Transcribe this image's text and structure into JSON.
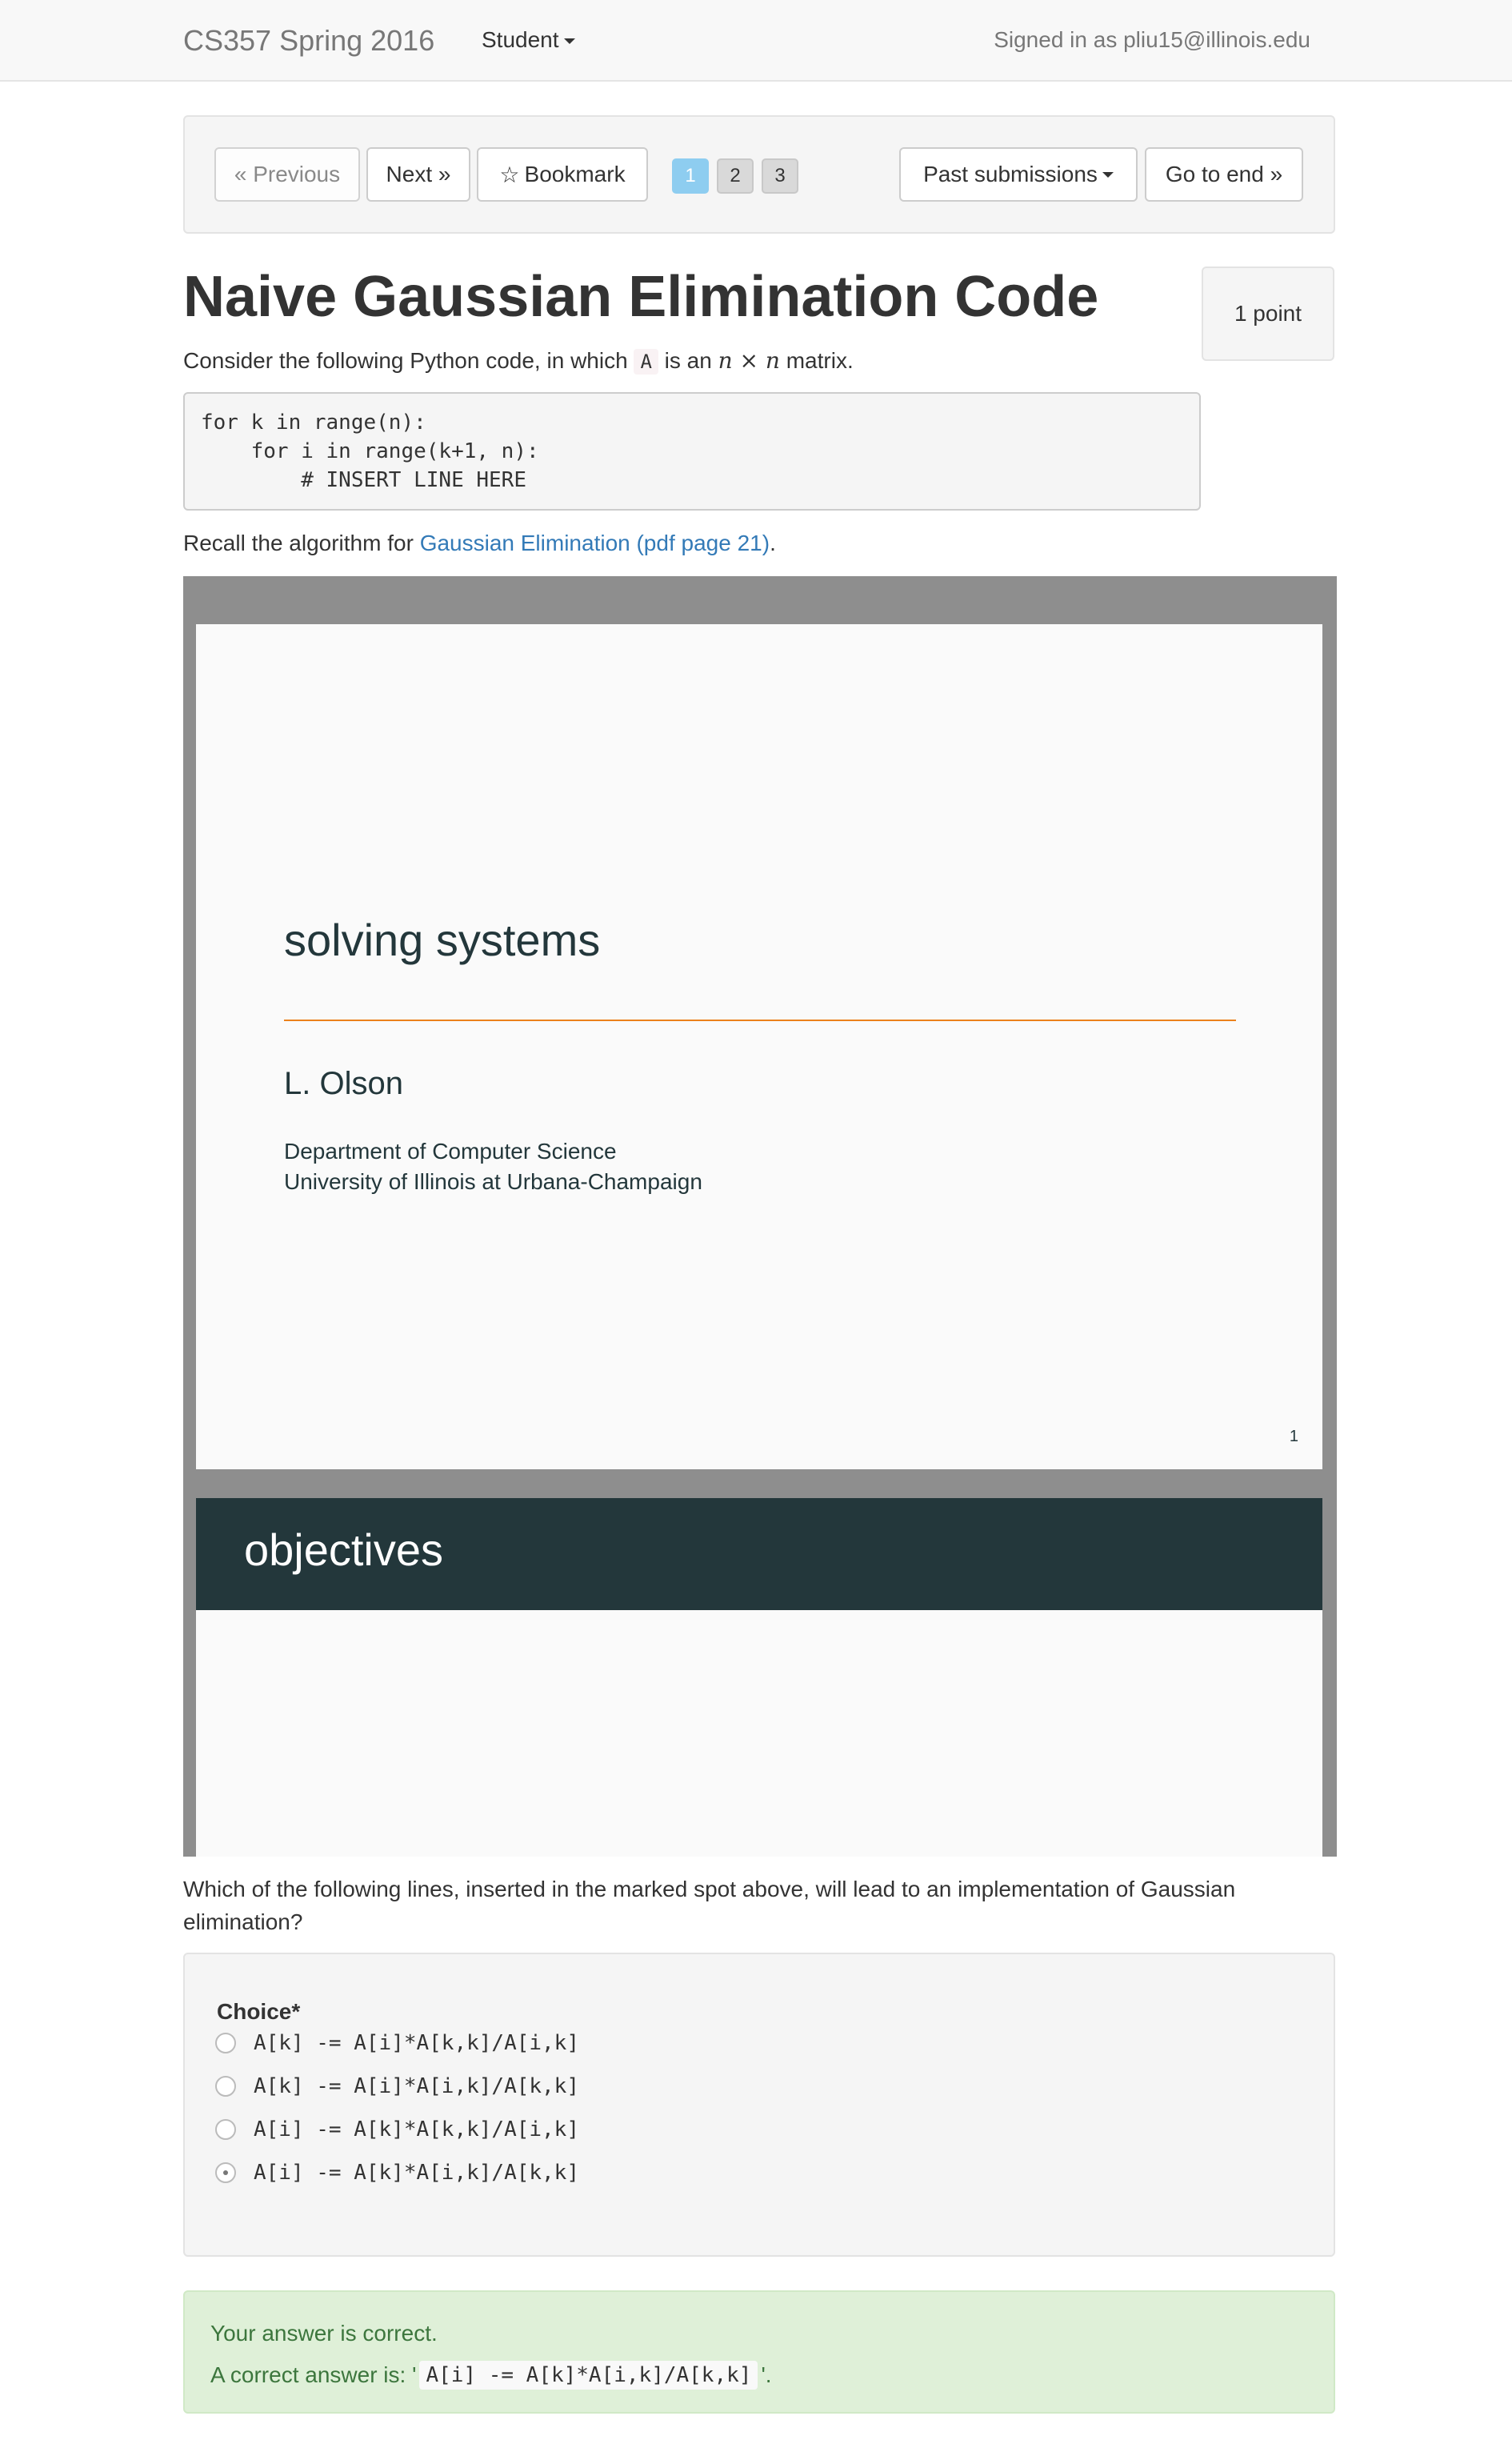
{
  "navbar": {
    "brand": "CS357 Spring 2016",
    "role": "Student",
    "signed_in": "Signed in as pliu15@illinois.edu"
  },
  "pager": {
    "previous": "« Previous",
    "next": "Next »",
    "bookmark": "Bookmark",
    "pages": [
      "1",
      "2",
      "3"
    ],
    "active_page": "1",
    "past_submissions": "Past submissions",
    "go_to_end": "Go to end »"
  },
  "question": {
    "title": "Naive Gaussian Elimination Code",
    "points": "1 point",
    "prompt_before": "Consider the following Python code, in which",
    "prompt_var": "A",
    "prompt_mid": "is an",
    "prompt_math": "n × n",
    "prompt_after": "matrix.",
    "code_line_1": "for k in range(n):",
    "code_line_2": "    for i in range(k+1, n):",
    "code_line_3": "        # INSERT LINE HERE",
    "recall_before": "Recall the algorithm for",
    "recall_link": "Gaussian Elimination (pdf page 21)",
    "recall_after": ".",
    "body": "Which of the following lines, inserted in the marked spot above, will lead to an implementation of Gaussian elimination?"
  },
  "pdf": {
    "slide1_title": "solving systems",
    "slide1_author": "L. Olson",
    "slide1_dept": "Department of Computer Science",
    "slide1_univ": "University of Illinois at Urbana-Champaign",
    "slide1_page": "1",
    "slide2_title": "objectives"
  },
  "choices": {
    "label": "Choice*",
    "options": [
      "A[k] -= A[i]*A[k,k]/A[i,k]",
      "A[k] -= A[i]*A[i,k]/A[k,k]",
      "A[i] -= A[k]*A[k,k]/A[i,k]",
      "A[i] -= A[k]*A[i,k]/A[k,k]"
    ],
    "selected_index": 3
  },
  "result": {
    "status": "Your answer is correct.",
    "correct_prefix": "A correct answer is: '",
    "correct_code": "A[i] -= A[k]*A[i,k]/A[k,k]",
    "correct_suffix": "'."
  },
  "colors": {
    "navbar_bg": "#f8f8f8",
    "link": "#337ab7",
    "success_bg": "#dff0d8",
    "success_text": "#3c763d",
    "slide_accent": "#eb811b",
    "slide_dark": "#23373b",
    "page_active": "#8ecdf0"
  }
}
